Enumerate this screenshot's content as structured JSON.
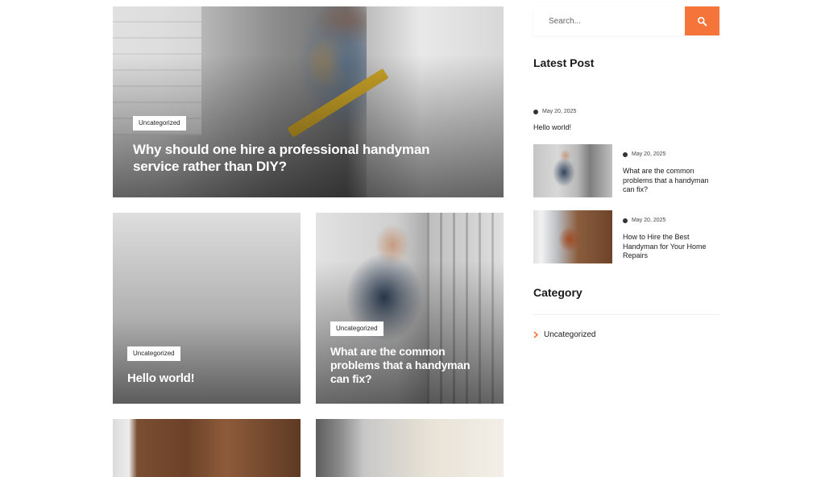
{
  "colors": {
    "accent": "#f5743a",
    "text": "#1a1a1a",
    "badge_bg": "#ffffff"
  },
  "posts": {
    "featured": {
      "category": "Uncategorized",
      "title": "Why should one hire a professional handyman service rather than DIY?"
    },
    "hello": {
      "category": "Uncategorized",
      "title": "Hello world!"
    },
    "problems": {
      "category": "Uncategorized",
      "title": "What are the common problems that a handyman can fix?"
    }
  },
  "sidebar": {
    "search": {
      "placeholder": "Search...",
      "button_icon": "search-icon"
    },
    "latest_title": "Latest Post",
    "latest": [
      {
        "date": "May 20, 2025",
        "title": "Hello world!"
      },
      {
        "date": "May 20, 2025",
        "title": "What are the common problems that a handyman can fix?"
      },
      {
        "date": "May 20, 2025",
        "title": "How to Hire the Best Handyman for Your Home Repairs"
      }
    ],
    "category_title": "Category",
    "categories": [
      {
        "label": "Uncategorized",
        "icon": "chevron-right-icon"
      }
    ]
  }
}
